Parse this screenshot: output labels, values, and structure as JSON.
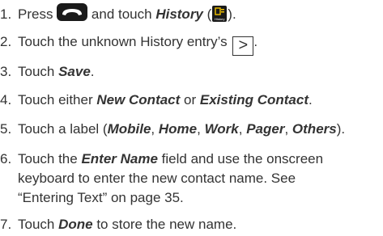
{
  "steps": [
    {
      "num": "1.",
      "p1": "Press ",
      "p2": " and touch ",
      "history": "History",
      "p3": " (",
      "icon_label": "History",
      "p4": ")."
    },
    {
      "num": "2.",
      "p1": "Touch the unknown History entry’s ",
      "arrow": ">",
      "p2": "."
    },
    {
      "num": "3.",
      "p1": "Touch ",
      "save": "Save",
      "p2": "."
    },
    {
      "num": "4.",
      "p1": "Touch either ",
      "new_contact": "New Contact",
      "p2": " or ",
      "existing_contact": "Existing Contact",
      "p3": "."
    },
    {
      "num": "5.",
      "p1": "Touch a label (",
      "l1": "Mobile",
      "l2": "Home",
      "l3": "Work",
      "l4": "Pager",
      "l5": "Others",
      "sep": ", ",
      "p2": ")."
    },
    {
      "num": "6.",
      "p1": "Touch the ",
      "enter_name": "Enter Name",
      "p2": " field and use the onscreen",
      "line2": "keyboard to enter the new contact name. See",
      "line3": "“Entering Text” on page 35."
    },
    {
      "num": "7.",
      "p1": "Touch ",
      "done": "Done",
      "p2": " to store the new name."
    }
  ],
  "icons": {
    "talk_key": "phone-handset-icon",
    "history_icon": "history-icon",
    "arrow_box": "chevron-right-icon"
  },
  "colors": {
    "text": "#333333",
    "key": "#1a1a1a"
  }
}
